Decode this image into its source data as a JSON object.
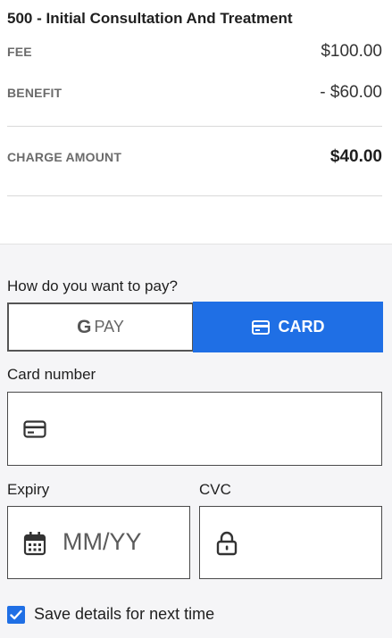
{
  "summary": {
    "title": "500 - Initial Consultation And Treatment",
    "fee_label": "FEE",
    "fee_value": "$100.00",
    "benefit_label": "BENEFIT",
    "benefit_value": "- $60.00",
    "charge_label": "CHARGE AMOUNT",
    "charge_value": "$40.00"
  },
  "payment": {
    "question": "How do you want to pay?",
    "gpay_g": "G",
    "gpay_label": "PAY",
    "card_label": "CARD",
    "selected": "card",
    "accent": "#1f6fe5"
  },
  "card_form": {
    "card_number_label": "Card number",
    "card_number_value": "",
    "expiry_label": "Expiry",
    "expiry_placeholder": "MM/YY",
    "cvc_label": "CVC",
    "cvc_value": ""
  },
  "save": {
    "checked": true,
    "label": "Save details for next time"
  },
  "icons": {
    "card": "credit-card-icon",
    "calendar": "calendar-icon",
    "lock": "lock-icon",
    "check": "checkmark-icon"
  }
}
